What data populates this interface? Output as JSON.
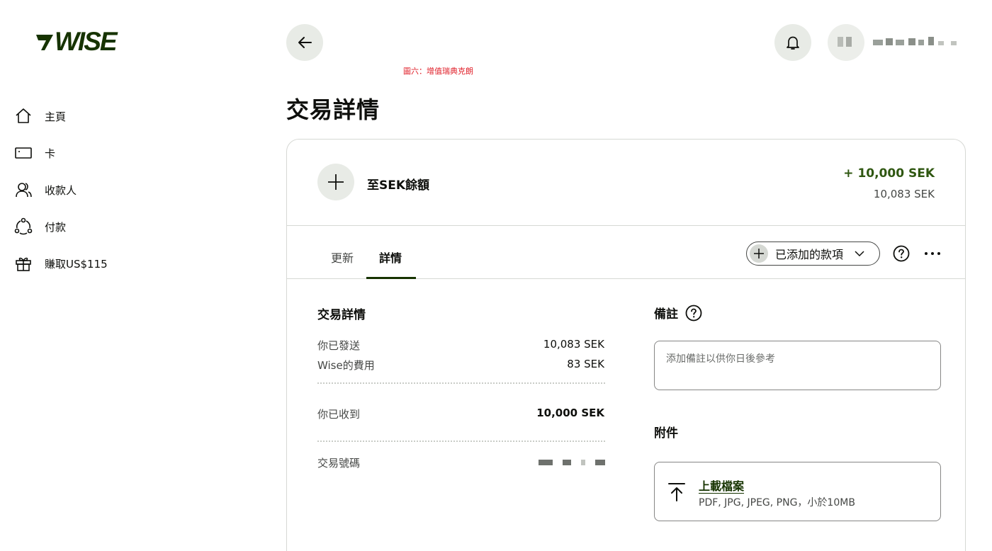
{
  "brand": {
    "name": "WISE",
    "color": "#163300"
  },
  "sidebar": {
    "items": [
      {
        "label": "主頁",
        "icon": "home-icon"
      },
      {
        "label": "卡",
        "icon": "card-icon"
      },
      {
        "label": "收款人",
        "icon": "recipients-icon"
      },
      {
        "label": "付款",
        "icon": "payments-icon"
      },
      {
        "label": "賺取US$115",
        "icon": "gift-icon"
      }
    ]
  },
  "header": {
    "caption": "圖六：增值瑞典克朗",
    "page_title": "交易詳情"
  },
  "transaction": {
    "title": "至SEK餘額",
    "amount": "+ 10,000 SEK",
    "sub_amount": "10,083 SEK",
    "amount_color": "#2f5711"
  },
  "tabs": [
    {
      "label": "更新",
      "active": false
    },
    {
      "label": "詳情",
      "active": true
    }
  ],
  "added_items": {
    "label": "已添加的款項"
  },
  "details": {
    "title": "交易詳情",
    "rows": [
      {
        "label": "你已發送",
        "value": "10,083 SEK"
      },
      {
        "label": "Wise的費用",
        "value": "83 SEK"
      }
    ],
    "received": {
      "label": "你已收到",
      "value": "10,000 SEK"
    },
    "reference": {
      "label": "交易號碼"
    }
  },
  "notes": {
    "title": "備註",
    "placeholder": "添加備註以供你日後參考"
  },
  "attachments": {
    "title": "附件",
    "upload_label": "上載檔案",
    "hint": "PDF, JPG, JPEG, PNG，小於10MB"
  }
}
